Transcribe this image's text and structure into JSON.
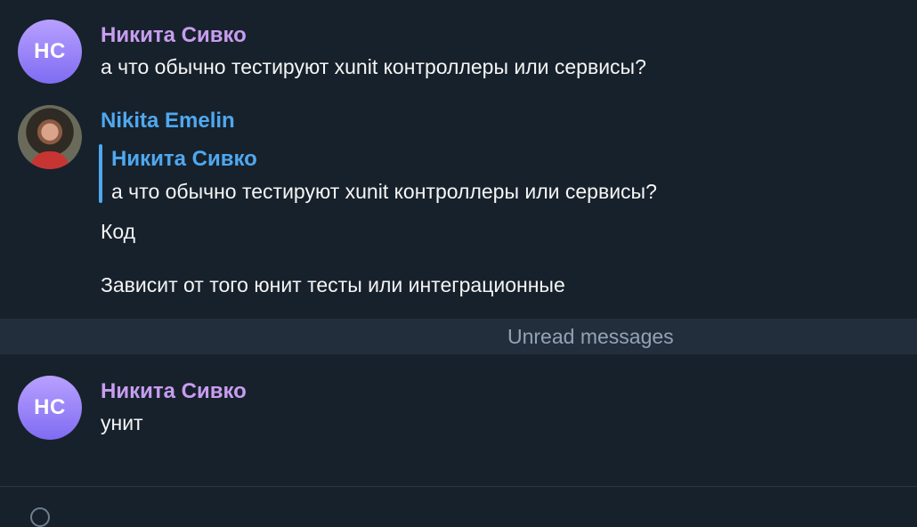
{
  "chat": {
    "messages": [
      {
        "avatar": "НС",
        "sender": "Никита Сивко",
        "sender_color": "#c79df0",
        "text": "а что обычно тестируют xunit контроллеры или сервисы?"
      },
      {
        "avatar_icon": "profile-photo-icon",
        "sender": "Nikita Emelin",
        "sender_color": "#4fa8ef",
        "reply": {
          "sender": "Никита Сивко",
          "text": "а что обычно тестируют xunit контроллеры или сервисы?"
        },
        "text_1": "Код",
        "text_2": "Зависит от того юнит тесты или интеграционные"
      },
      {
        "avatar": "НС",
        "sender": "Никита Сивко",
        "sender_color": "#c79df0",
        "text": "унит"
      }
    ],
    "unread_label": "Unread messages"
  },
  "colors": {
    "background": "#17212b",
    "divider_background": "#232e3c",
    "text": "#f5f5f5",
    "muted_text": "#93a3b5"
  }
}
